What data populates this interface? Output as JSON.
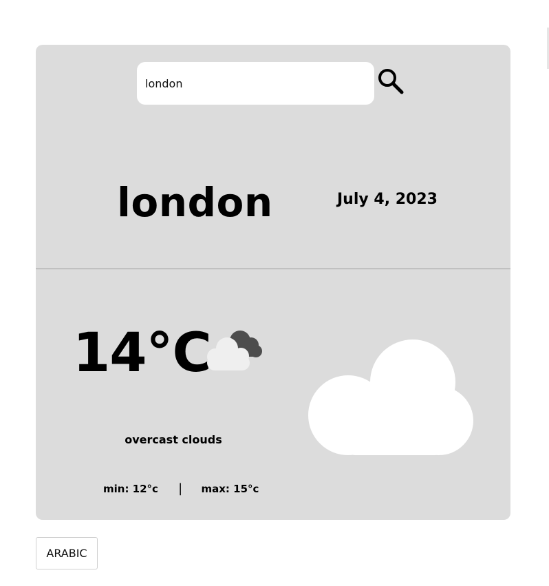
{
  "search": {
    "value": "london",
    "button_icon": "search-icon"
  },
  "weather": {
    "city": "london",
    "date": "July 4, 2023",
    "temperature": "14°C",
    "condition_icon": "cloud-icon",
    "description": "overcast clouds",
    "min": "min: 12°c",
    "separator": "|",
    "max": "max: 15°c"
  },
  "language_button": {
    "label": "ARABIC"
  },
  "colors": {
    "card_background": "#dcdcdc",
    "page_background": "#ffffff",
    "cloud_white": "#ffffff",
    "cloud_light": "#eeeeee",
    "cloud_dark": "#555555"
  }
}
